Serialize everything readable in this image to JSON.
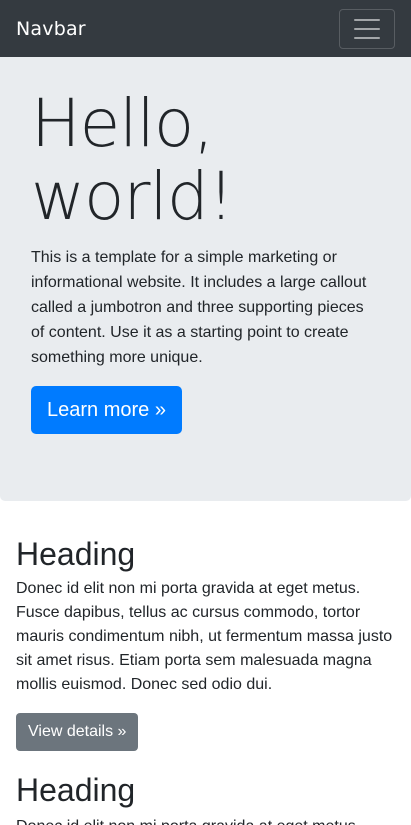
{
  "navbar": {
    "brand": "Navbar",
    "toggler_icon": "hamburger-menu-icon"
  },
  "jumbotron": {
    "title_line1": "Hello,",
    "title_line2": "world!",
    "text": "This is a template for a simple marketing or informational website. It includes a large callout called a jumbotron and three supporting pieces of content. Use it as a starting point to create something more unique.",
    "button_label": "Learn more »"
  },
  "sections": [
    {
      "heading": "Heading",
      "text": "Donec id elit non mi porta gravida at eget metus. Fusce dapibus, tellus ac cursus commodo, tortor mauris condimentum nibh, ut fermentum massa justo sit amet risus. Etiam porta sem malesuada magna mollis euismod. Donec sed odio dui.",
      "button_label": "View details »"
    },
    {
      "heading": "Heading",
      "text": "Donec id elit non mi porta gravida at eget metus."
    }
  ],
  "colors": {
    "navbar_bg": "#343a40",
    "jumbotron_bg": "#e9ecef",
    "primary": "#007bff",
    "secondary": "#6c757d"
  }
}
